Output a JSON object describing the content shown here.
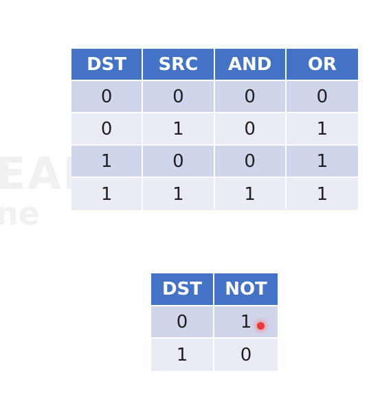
{
  "watermark": {
    "line1": "EAD",
    "line2": "ne"
  },
  "main_table": {
    "headers": [
      "DST",
      "SRC",
      "AND",
      "OR"
    ],
    "rows": [
      [
        "0",
        "0",
        "0",
        "0"
      ],
      [
        "0",
        "1",
        "0",
        "1"
      ],
      [
        "1",
        "0",
        "0",
        "1"
      ],
      [
        "1",
        "1",
        "1",
        "1"
      ]
    ]
  },
  "not_table": {
    "headers": [
      "DST",
      "NOT"
    ],
    "rows": [
      [
        "0",
        "1"
      ],
      [
        "1",
        "0"
      ]
    ]
  },
  "colors": {
    "header_bg": "#4472c4",
    "row_dark": "#cfd5ea",
    "row_light": "#e9ebf5",
    "cursor": "#e83a3a"
  }
}
